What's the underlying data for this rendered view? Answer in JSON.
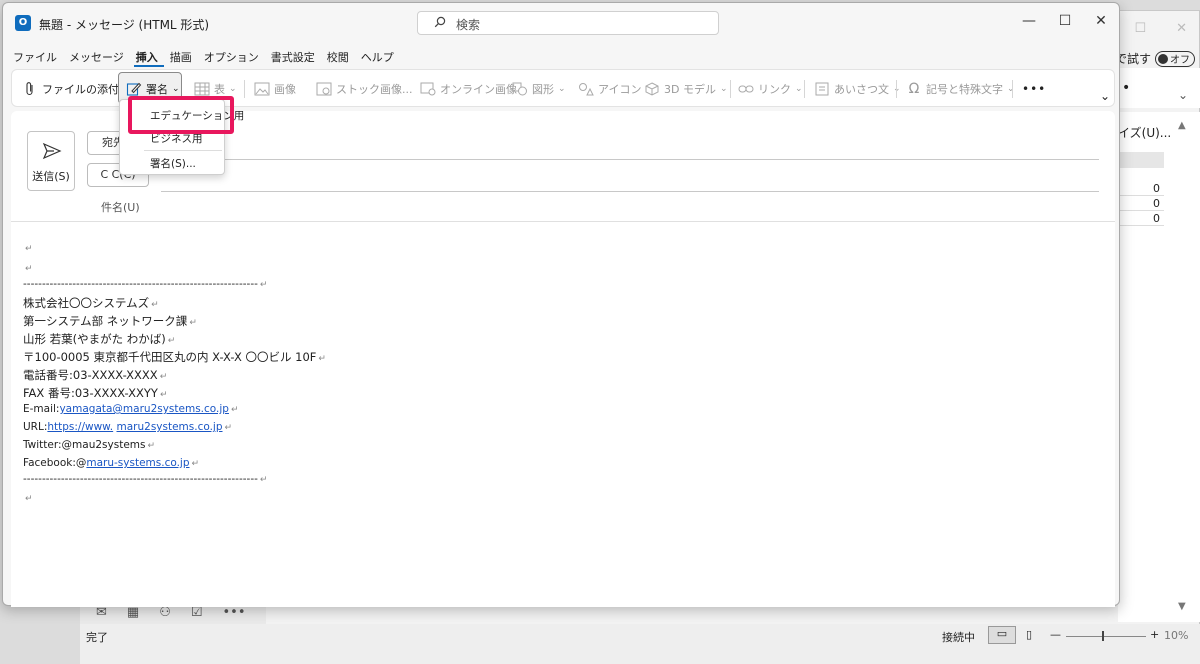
{
  "window": {
    "title": "無題 - メッセージ (HTML 形式)",
    "app_icon_letter": "O",
    "search_placeholder": "検索",
    "buttons": {
      "minimize": "—",
      "maximize": "☐",
      "close": "✕"
    }
  },
  "menubar": [
    "ファイル",
    "メッセージ",
    "挿入",
    "描画",
    "オプション",
    "書式設定",
    "校閲",
    "ヘルプ"
  ],
  "menubar_active": "挿入",
  "ribbon": {
    "attach": "ファイルの添付",
    "signature": "署名",
    "table": "表",
    "picture": "画像",
    "stock_images": "ストック画像...",
    "online_pictures": "オンライン画像",
    "shapes": "図形",
    "icons": "アイコン",
    "models_3d": "3D モデル",
    "link": "リンク",
    "greeting": "あいさつ文",
    "symbols": "記号と特殊文字",
    "more": "•••"
  },
  "signature_menu": {
    "items": [
      "エデュケーション用",
      "ビジネス用",
      "署名(S)..."
    ]
  },
  "compose": {
    "send": "送信(S)",
    "to": "宛先",
    "cc": "C C(C)",
    "subject": "件名(U)"
  },
  "body": {
    "para_mark": "↵",
    "separator": "--------------------------------------------------------------",
    "company": "株式会社〇〇システムズ",
    "dept": "第一システム部 ネットワーク課",
    "name": "山形 若葉(やまがた わかば)",
    "address": "〒100-0005 東京都千代田区丸の内 X-X-X 〇〇ビル 10F",
    "tel": "電話番号:03-XXXX-XXXX",
    "fax": "FAX 番号:03-XXXX-XXYY",
    "email_label": "E-mail:",
    "email": "yamagata@maru2systems.co.jp",
    "url_label": "URL:",
    "url_a": "https://www.",
    "url_b": "maru2systems.co.jp",
    "twitter": "Twitter:@mau2systems",
    "facebook_label": "Facebook:@",
    "facebook": "maru-systems.co.jp"
  },
  "background_window": {
    "try_label": "で試す",
    "toggle": "オフ",
    "size_label": "イズ(U)...",
    "counts": [
      "0",
      "0",
      "0"
    ],
    "status_ready": "完了",
    "status_connected": "接続中",
    "zoom": "10%",
    "zoom_minus": "—",
    "zoom_plus": "+",
    "nav_icons": [
      "✉",
      "▦",
      "⚇",
      "☑",
      "•••"
    ],
    "dot": "•",
    "chevron": "⌄",
    "title_buttons": [
      "☐",
      "✕"
    ],
    "scroll_up": "▲",
    "scroll_down": "▼",
    "view_normal": "▭",
    "view_reading": "▯"
  }
}
